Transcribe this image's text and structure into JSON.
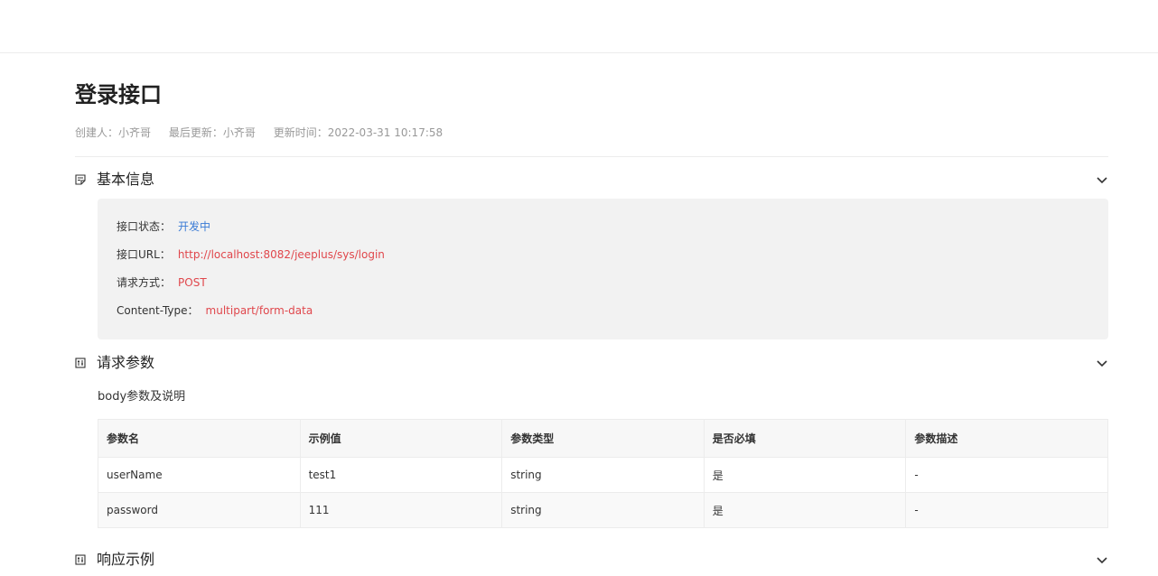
{
  "doc": {
    "title": "登录接口",
    "meta": {
      "creator": "创建人：小齐哥",
      "last_updater": "最后更新：小齐哥",
      "updated_time": "更新时间：2022-03-31 10:17:58"
    }
  },
  "sections": {
    "basic": {
      "title": "基本信息",
      "icon": "note-icon",
      "rows": [
        {
          "label": "接口状态：",
          "value": "开发中",
          "color": "#3a7bd5"
        },
        {
          "label": "接口URL：",
          "value": "http://localhost:8082/jeeplus/sys/login",
          "color": "#e0474c"
        },
        {
          "label": "请求方式：",
          "value": "POST",
          "color": "#e0474c"
        },
        {
          "label": "Content-Type：",
          "value": "multipart/form-data",
          "color": "#e0474c"
        }
      ]
    },
    "request": {
      "title": "请求参数",
      "icon": "params-icon",
      "body_caption": "body参数及说明",
      "table": {
        "headers": [
          "参数名",
          "示例值",
          "参数类型",
          "是否必填",
          "参数描述"
        ],
        "rows": [
          [
            "userName",
            "test1",
            "string",
            "是",
            "-"
          ],
          [
            "password",
            "111",
            "string",
            "是",
            "-"
          ]
        ]
      }
    },
    "response": {
      "title": "响应示例",
      "icon": "params-icon"
    }
  },
  "icons": {
    "expand": "chevron-down-icon"
  }
}
